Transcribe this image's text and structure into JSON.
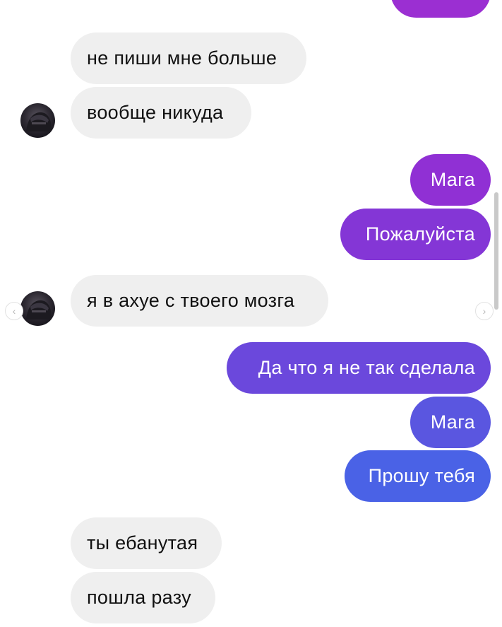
{
  "colors": {
    "incoming_bubble": "#efefef",
    "outgoing_gradient_top": "#9b30d0",
    "outgoing_gradient_bottom": "#3f6bea"
  },
  "messages": [
    {
      "side": "outgoing",
      "text": ""
    },
    {
      "side": "incoming",
      "text": "не пиши мне больше"
    },
    {
      "side": "incoming",
      "text": "вообще никуда"
    },
    {
      "side": "outgoing",
      "text": "Мага"
    },
    {
      "side": "outgoing",
      "text": "Пожалуйста"
    },
    {
      "side": "incoming",
      "text": "я в ахуе с твоего мозга"
    },
    {
      "side": "outgoing",
      "text": "Да что я не так сделала"
    },
    {
      "side": "outgoing",
      "text": "Мага"
    },
    {
      "side": "outgoing",
      "text": "Прошу тебя"
    },
    {
      "side": "incoming",
      "text": "ты ебанутая"
    },
    {
      "side": "incoming",
      "text": "пошла разу"
    }
  ],
  "icons": {
    "avatar": "contact-avatar",
    "prev": "chevron-left-icon",
    "next": "chevron-right-icon"
  },
  "nav": {
    "prev_glyph": "‹",
    "next_glyph": "›"
  }
}
